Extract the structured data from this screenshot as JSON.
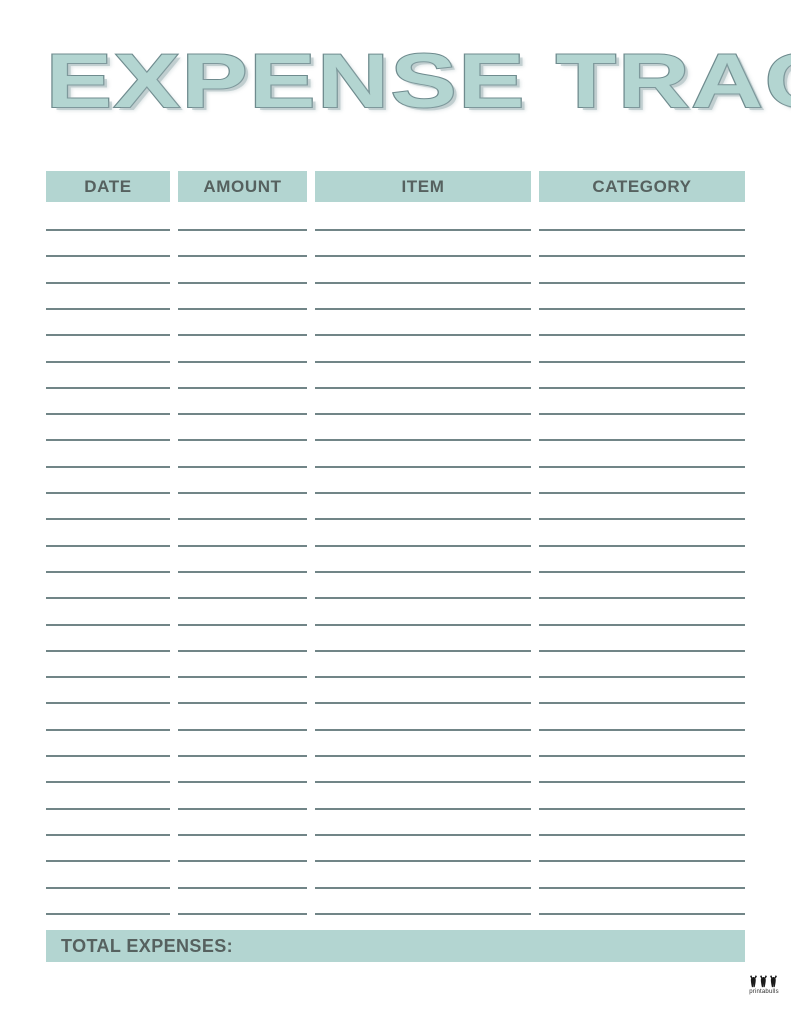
{
  "document": {
    "title": "EXPENSE TRACKER",
    "type": "printable-worksheet"
  },
  "table": {
    "columns": [
      {
        "label": "DATE"
      },
      {
        "label": "AMOUNT"
      },
      {
        "label": "ITEM"
      },
      {
        "label": "CATEGORY"
      }
    ],
    "row_count": 27,
    "rows_are_blank": true
  },
  "total": {
    "label": "TOTAL EXPENSES:",
    "value": ""
  },
  "footer": {
    "brand": "printabulls",
    "logo_icon": "three-bulls-icon"
  },
  "colors": {
    "accent_teal": "#b3d5d1",
    "rule_line": "#718587",
    "text_dark": "#56615f",
    "title_outline": "#6f8b8e",
    "page_background": "#ffffff"
  }
}
